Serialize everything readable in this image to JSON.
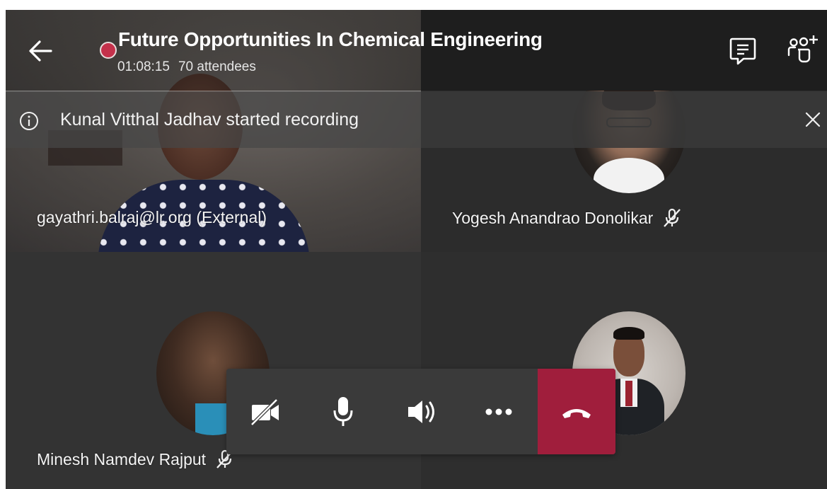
{
  "meeting": {
    "title": "Future Opportunities In Chemical Engineering",
    "duration": "01:08:15",
    "attendees": "70 attendees",
    "recording": true
  },
  "notification": {
    "text": "Kunal Vitthal Jadhav started recording",
    "icon": "info-icon"
  },
  "participants": [
    {
      "name": "gayathri.balraj@lr.org (External)",
      "muted": false,
      "video": true
    },
    {
      "name": "Yogesh Anandrao Donolikar",
      "muted": true,
      "video": false
    },
    {
      "name": "Minesh Namdev Rajput",
      "muted": true,
      "video": false
    },
    {
      "name": "",
      "muted": false,
      "video": false
    }
  ],
  "header_icons": {
    "back": "arrow-left-icon",
    "chat": "chat-icon",
    "people": "add-people-icon"
  },
  "controls": [
    {
      "name": "camera-off-icon"
    },
    {
      "name": "microphone-icon"
    },
    {
      "name": "speaker-icon"
    },
    {
      "name": "more-options-icon"
    },
    {
      "name": "hang-up-icon"
    }
  ],
  "colors": {
    "recording": "#c4314b",
    "hangup": "#a01e3c",
    "controls_bg": "#3a3a3a"
  }
}
